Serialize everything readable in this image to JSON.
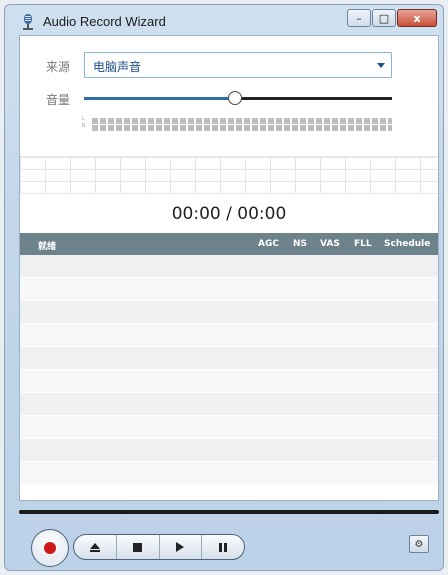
{
  "window": {
    "title": "Audio Record Wizard",
    "controls": {
      "minimize": "–",
      "maximize": "□",
      "close": "x"
    }
  },
  "source": {
    "label": "来源",
    "value": "电脑声音"
  },
  "volume": {
    "label": "音量",
    "level_percent": 49,
    "meter_channels": [
      "L",
      "R"
    ]
  },
  "timer": {
    "elapsed": "00:00",
    "separator": "/",
    "total": "00:00"
  },
  "table": {
    "headers": {
      "status": "就绪",
      "agc": "AGC",
      "ns": "NS",
      "vas": "VAS",
      "fll": "FLL",
      "schedule": "Schedule"
    },
    "row_count": 10
  },
  "transport": {
    "record_icon": "record-icon",
    "eject_icon": "eject-icon",
    "stop_icon": "stop-icon",
    "play_icon": "play-icon",
    "pause_icon": "pause-icon"
  },
  "colors": {
    "accent": "#2d6ea8",
    "header_bg": "#6e828c",
    "record": "#d01818"
  }
}
